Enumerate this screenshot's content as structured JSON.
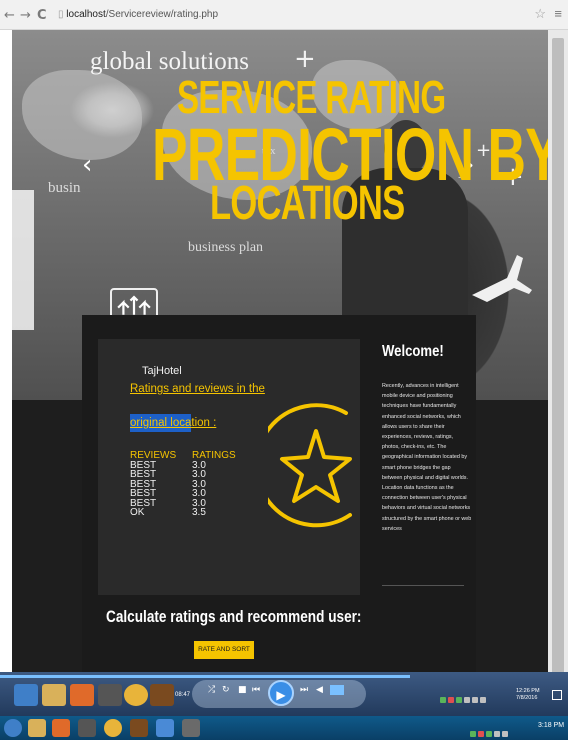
{
  "browser": {
    "url_host": "localhost",
    "url_path": "/Servicereview/rating.php",
    "back_icon": "arrow-left-icon",
    "forward_icon": "arrow-right-icon",
    "reload_icon": "reload-icon"
  },
  "hero": {
    "brand_text": "global solutions",
    "title_line1": "SERVICE RATING",
    "title_line2": "PREDICTION BY",
    "title_line3": "LOCATIONS",
    "bg_word1": "busin",
    "bg_word2": "tax",
    "bg_word3": "business plan",
    "prev_arrow": "‹",
    "next_arrow": "›"
  },
  "card": {
    "hotel_name": "TajHotel",
    "subhead_line1": "Ratings and reviews in the",
    "subhead_line2_highlight": "original loca",
    "subhead_line2_rest": "tion :",
    "table_headers": [
      "REVIEWS",
      "RATINGS"
    ],
    "rows": [
      [
        "BEST",
        "3.0"
      ],
      [
        "BEST",
        "3.0"
      ],
      [
        "BEST",
        "3.0"
      ],
      [
        "BEST",
        "3.0"
      ],
      [
        "BEST",
        "3.0"
      ],
      [
        "OK",
        "3.5"
      ]
    ]
  },
  "welcome": {
    "title": "Welcome!",
    "body": "Recently, advances in intelligent mobile device and positioning techniques have fundamentally enhanced social networks, which allows users to share their experiences, reviews, ratings, photos, check-ins, etc. The geographical information located by smart phone bridges the gap between physical and digital worlds. Location data functions as the connection between user's physical behaviors and virtual social networks structured by the smart phone or web services"
  },
  "calc": {
    "title": "Calculate ratings and recommend user:",
    "button_label": "RATE AND SORT"
  },
  "player": {
    "time": "08:47",
    "clock_time": "12:26 PM",
    "clock_date": "7/8/2016"
  },
  "taskbar": {
    "clock": "3:18 PM"
  },
  "colors": {
    "accent_yellow": "#f5c400",
    "panel_dark": "#1b1b1b",
    "card_dark": "#2a2a2a",
    "highlight_blue": "#1d60c8"
  }
}
